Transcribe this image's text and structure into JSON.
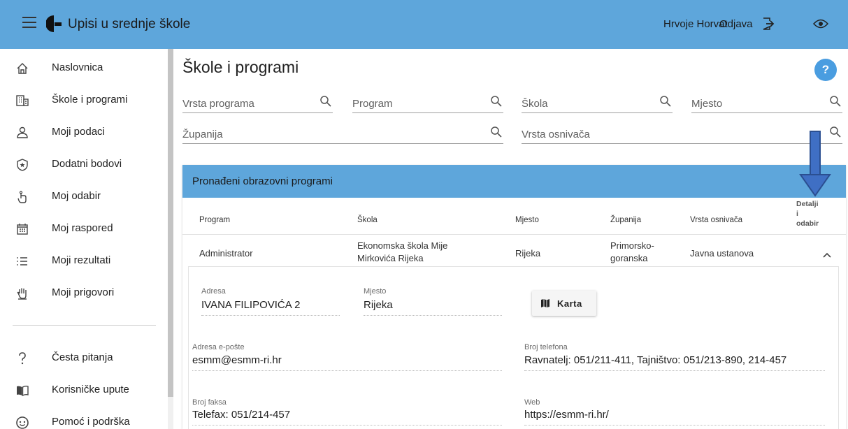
{
  "header": {
    "app_title": "Upisi u srednje škole",
    "user_name": "Hrvoje Horvat",
    "logout_label": "Odjava",
    "bar_color": "#5ea6db"
  },
  "sidebar": {
    "items": [
      {
        "label": "Naslovnica",
        "icon": "home-icon"
      },
      {
        "label": "Škole i programi",
        "icon": "building-icon"
      },
      {
        "label": "Moji podaci",
        "icon": "user-icon"
      },
      {
        "label": "Dodatni bodovi",
        "icon": "shield-star-icon"
      },
      {
        "label": "Moj odabir",
        "icon": "touch-icon"
      },
      {
        "label": "Moj raspored",
        "icon": "calendar-icon"
      },
      {
        "label": "Moji rezultati",
        "icon": "list-icon"
      },
      {
        "label": "Moji prigovori",
        "icon": "hand-icon"
      }
    ],
    "bottom_items": [
      {
        "label": "Česta pitanja",
        "icon": "question-icon"
      },
      {
        "label": "Korisničke upute",
        "icon": "book-icon"
      },
      {
        "label": "Pomoć i podrška",
        "icon": "support-icon"
      }
    ]
  },
  "main": {
    "page_title": "Škole i programi",
    "help_label": "?",
    "filters": {
      "vrsta_programa": "Vrsta programa",
      "program": "Program",
      "skola": "Škola",
      "mjesto": "Mjesto",
      "zupanija": "Županija",
      "vrsta_osnivaca": "Vrsta osnivača"
    }
  },
  "results": {
    "title": "Pronađeni obrazovni programi",
    "columns": {
      "program": "Program",
      "skola": "Škola",
      "mjesto": "Mjesto",
      "zupanija": "Županija",
      "vrsta_osnivaca": "Vrsta osnivača",
      "detalji_1": "Detalji",
      "detalji_2": "i",
      "detalji_3": "odabir"
    },
    "row": {
      "program": "Administrator",
      "skola_1": "Ekonomska škola Mije",
      "skola_2": "Mirkovića Rijeka",
      "mjesto": "Rijeka",
      "zupanija_1": "Primorsko-",
      "zupanija_2": "goranska",
      "vrsta_osnivaca": "Javna ustanova"
    },
    "details": {
      "adresa_label": "Adresa",
      "adresa": "IVANA FILIPOVIĆA 2",
      "mjesto_label": "Mjesto",
      "mjesto": "Rijeka",
      "karta_label": "Karta",
      "email_label": "Adresa e-pošte",
      "email": "esmm@esmm-ri.hr",
      "telefon_label": "Broj telefona",
      "telefon": "Ravnatelj: 051/211-411, Tajništvo: 051/213-890, 214-457",
      "faks_label": "Broj faksa",
      "faks": "Telefax: 051/214-457",
      "web_label": "Web",
      "web": "https://esmm-ri.hr/"
    }
  }
}
